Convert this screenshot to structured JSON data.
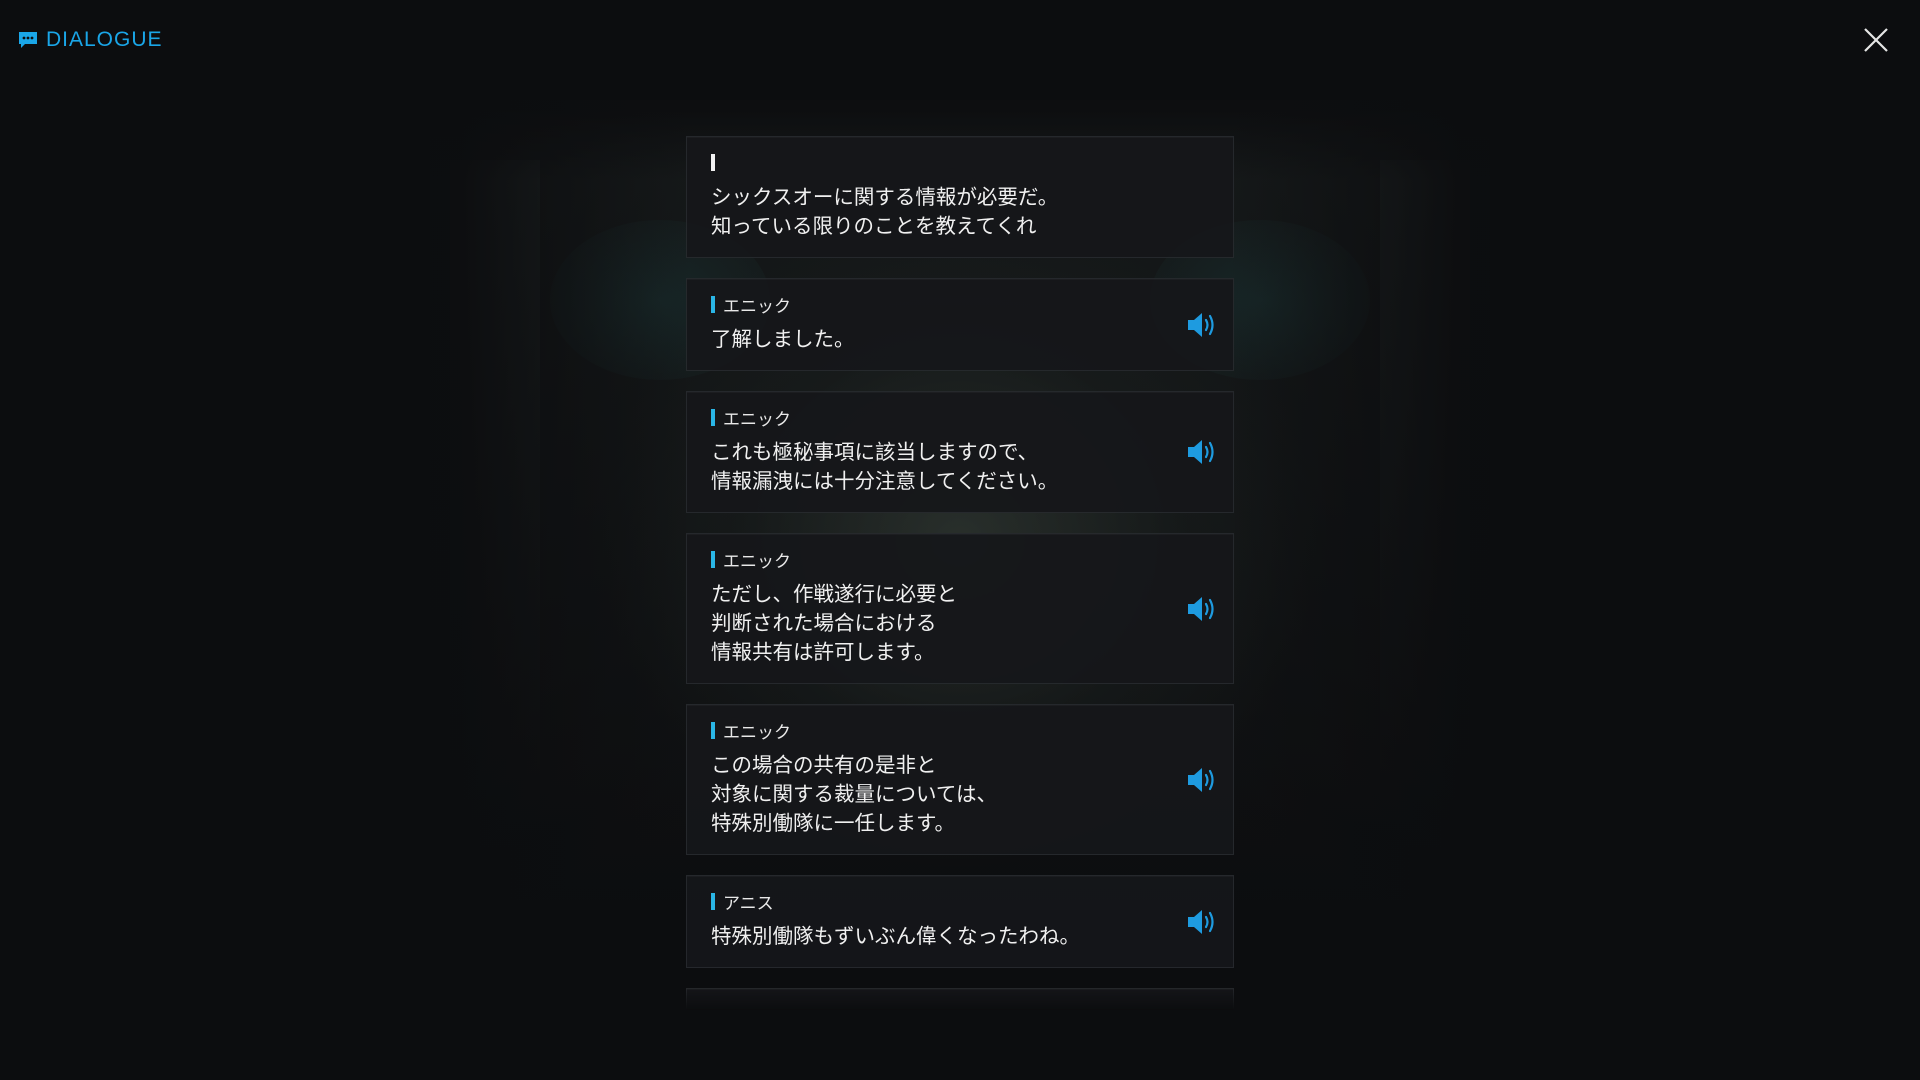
{
  "header": {
    "title": "DIALOGUE",
    "icon": "chat-bubble-icon",
    "accent_color": "#1aa6e8"
  },
  "close_icon": "close-icon",
  "dialogue": [
    {
      "speaker": "",
      "is_player": true,
      "has_voice": false,
      "text": "シックスオーに関する情報が必要だ。\n知っている限りのことを教えてくれ"
    },
    {
      "speaker": "エニック",
      "is_player": false,
      "has_voice": true,
      "text": "了解しました。"
    },
    {
      "speaker": "エニック",
      "is_player": false,
      "has_voice": true,
      "text": "これも極秘事項に該当しますので、\n情報漏洩には十分注意してください。"
    },
    {
      "speaker": "エニック",
      "is_player": false,
      "has_voice": true,
      "text": "ただし、作戦遂行に必要と\n判断された場合における\n情報共有は許可します。"
    },
    {
      "speaker": "エニック",
      "is_player": false,
      "has_voice": true,
      "text": "この場合の共有の是非と\n対象に関する裁量については、\n特殊別働隊に一任します。"
    },
    {
      "speaker": "アニス",
      "is_player": false,
      "has_voice": true,
      "text": "特殊別働隊もずいぶん偉くなったわね。"
    }
  ],
  "voice_icon": "speaker-volume-icon",
  "voice_color": "#1e9be0",
  "speaker_bar_color": "#2ab6e6"
}
